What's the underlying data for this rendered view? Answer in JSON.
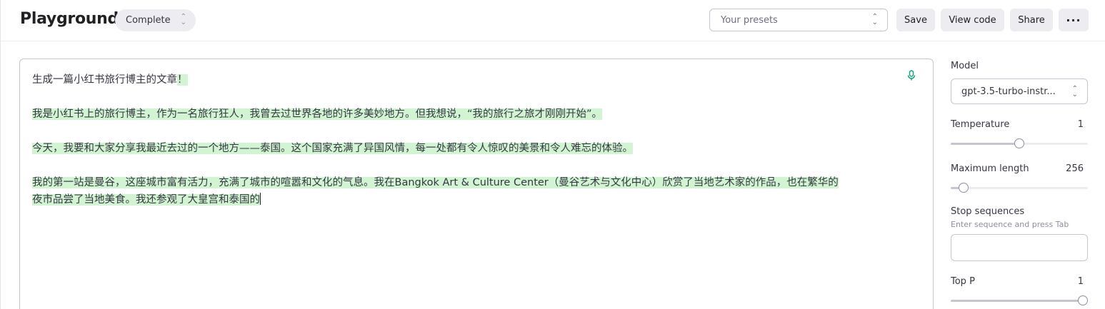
{
  "header": {
    "title": "Playground",
    "mode": "Complete",
    "presets_placeholder": "Your presets",
    "buttons": {
      "save": "Save",
      "view_code": "View code",
      "share": "Share",
      "more": "···"
    }
  },
  "editor": {
    "prompt": "生成一篇小红书旅行博主的文章",
    "completion_start": "！",
    "paragraphs": [
      "我是小红书上的旅行博主，作为一名旅行狂人，我曾去过世界各地的许多美妙地方。但我想说，“我的旅行之旅才刚刚开始”。",
      "今天，我要和大家分享我最近去过的一个地方——泰国。这个国家充满了异国风情，每一处都有令人惊叹的美景和令人难忘的体验。"
    ],
    "last_line_1": "我的第一站是曼谷，这座城市富有活力，充满了城市的喧嚣和文化的气息。我在Bangkok Art & Culture Center（曼谷艺术与文化中心）欣赏了当地艺术家的作品，也在繁华的",
    "last_line_2": "夜市品尝了当地美食。我还参观了大皇宫和泰国的"
  },
  "sidebar": {
    "model": {
      "label": "Model",
      "value": "gpt-3.5-turbo-instr..."
    },
    "temperature": {
      "label": "Temperature",
      "value": "1",
      "level": 0.5
    },
    "max_length": {
      "label": "Maximum length",
      "value": "256",
      "level": 0.06
    },
    "stop_sequences": {
      "label": "Stop sequences",
      "hint": "Enter sequence and press Tab"
    },
    "top_p": {
      "label": "Top P",
      "value": "1",
      "level": 1.0
    }
  },
  "colors": {
    "highlight": "#d2f4d3",
    "accent": "#10a37f"
  }
}
